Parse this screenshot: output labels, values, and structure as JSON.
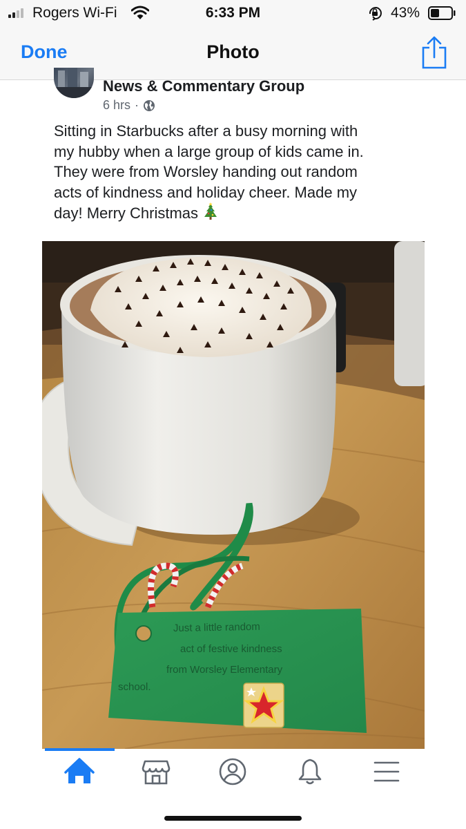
{
  "status_bar": {
    "carrier": "Rogers Wi-Fi",
    "time": "6:33 PM",
    "battery_percent": "43%",
    "battery_level": 0.43,
    "signal_bars_filled": 2,
    "icons": [
      "signal-icon",
      "wifi-icon",
      "orientation-lock-icon",
      "battery-icon"
    ]
  },
  "nav": {
    "done_label": "Done",
    "title": "Photo",
    "share_icon": "share-icon"
  },
  "post": {
    "group_name": "News & Commentary Group",
    "time_ago": "6 hrs",
    "separator": "·",
    "audience_icon": "globe-icon",
    "text_lines": [
      "Sitting in Starbucks after a busy morning with",
      "my hubby when a large group of kids came in.",
      "They were from Worsley handing out random",
      "acts of kindness and holiday cheer. Made my",
      "day!  Merry Christmas"
    ],
    "emoji": "christmas-tree-icon"
  },
  "photo": {
    "tag_text": "Just a little random act of festive kindness from Worsley Elementary school."
  },
  "tab_bar": {
    "tabs": [
      {
        "name": "home",
        "icon": "home-icon",
        "active": true
      },
      {
        "name": "marketplace",
        "icon": "marketplace-icon",
        "active": false
      },
      {
        "name": "profile",
        "icon": "profile-icon",
        "active": false
      },
      {
        "name": "notifications",
        "icon": "bell-icon",
        "active": false
      },
      {
        "name": "menu",
        "icon": "menu-icon",
        "active": false
      }
    ]
  },
  "colors": {
    "accent": "#1a7cf4",
    "text": "#1c1e21",
    "meta": "#606770",
    "bar_bg": "#f7f7f7"
  }
}
